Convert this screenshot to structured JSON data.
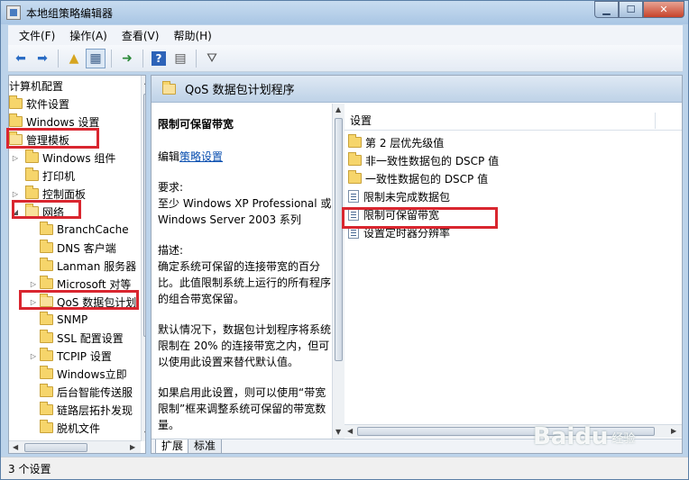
{
  "window": {
    "title": "本地组策略编辑器"
  },
  "menu": [
    "文件(F)",
    "操作(A)",
    "查看(V)",
    "帮助(H)"
  ],
  "toolbar": [
    "back-icon",
    "forward-icon",
    "up-folder-icon",
    "show-tree-icon",
    "export-icon",
    "help-icon",
    "properties-icon",
    "filter-icon"
  ],
  "tree": [
    {
      "label": "计算机配置",
      "indent": 0,
      "expander": "",
      "folder": false
    },
    {
      "label": "软件设置",
      "indent": 0,
      "expander": "",
      "folder": true
    },
    {
      "label": "Windows 设置",
      "indent": 0,
      "expander": "",
      "folder": true
    },
    {
      "label": "管理模板",
      "indent": 0,
      "expander": "",
      "folder": true
    },
    {
      "label": "Windows 组件",
      "indent": 1,
      "expander": "▷",
      "folder": true
    },
    {
      "label": "打印机",
      "indent": 1,
      "expander": "",
      "folder": true
    },
    {
      "label": "控制面板",
      "indent": 1,
      "expander": "▷",
      "folder": true
    },
    {
      "label": "网络",
      "indent": 1,
      "expander": "◢",
      "folder": true
    },
    {
      "label": "BranchCache",
      "indent": 2,
      "expander": "",
      "folder": true
    },
    {
      "label": "DNS 客户端",
      "indent": 2,
      "expander": "",
      "folder": true
    },
    {
      "label": "Lanman 服务器",
      "indent": 2,
      "expander": "",
      "folder": true
    },
    {
      "label": "Microsoft 对等",
      "indent": 2,
      "expander": "▷",
      "folder": true
    },
    {
      "label": "QoS 数据包计划",
      "indent": 2,
      "expander": "▷",
      "folder": true
    },
    {
      "label": "SNMP",
      "indent": 2,
      "expander": "",
      "folder": true
    },
    {
      "label": "SSL 配置设置",
      "indent": 2,
      "expander": "",
      "folder": true
    },
    {
      "label": "TCPIP 设置",
      "indent": 2,
      "expander": "▷",
      "folder": true
    },
    {
      "label": "Windows立即",
      "indent": 2,
      "expander": "",
      "folder": true
    },
    {
      "label": "后台智能传送服",
      "indent": 2,
      "expander": "",
      "folder": true
    },
    {
      "label": "链路层拓扑发现",
      "indent": 2,
      "expander": "",
      "folder": true
    },
    {
      "label": "脱机文件",
      "indent": 2,
      "expander": "",
      "folder": true
    }
  ],
  "right_header": {
    "title": "QoS 数据包计划程序"
  },
  "description": {
    "title": "限制可保留带宽",
    "edit_prefix": "编辑",
    "edit_link": "策略设置",
    "req_label": "要求:",
    "req_text": "至少 Windows XP Professional 或 Windows Server 2003 系列",
    "desc_label": "描述:",
    "desc_text": "确定系统可保留的连接带宽的百分比。此值限制系统上运行的所有程序的组合带宽保留。",
    "default_text": "默认情况下，数据包计划程序将系统限制在 20% 的连接带宽之内，但可以使用此设置来替代默认值。",
    "enable_text": "如果启用此设置，则可以使用“带宽限制”框来调整系统可保留的带宽数量。"
  },
  "list": {
    "column": "设置",
    "items": [
      {
        "label": "第 2 层优先级值",
        "type": "folder"
      },
      {
        "label": "非一致性数据包的 DSCP 值",
        "type": "folder"
      },
      {
        "label": "一致性数据包的 DSCP 值",
        "type": "folder"
      },
      {
        "label": "限制未完成数据包",
        "type": "setting"
      },
      {
        "label": "限制可保留带宽",
        "type": "setting"
      },
      {
        "label": "设置定时器分辨率",
        "type": "setting"
      }
    ]
  },
  "tabs": [
    "扩展",
    "标准"
  ],
  "status": "3 个设置",
  "watermark": {
    "brand": "Baidu",
    "sub": "经验"
  }
}
